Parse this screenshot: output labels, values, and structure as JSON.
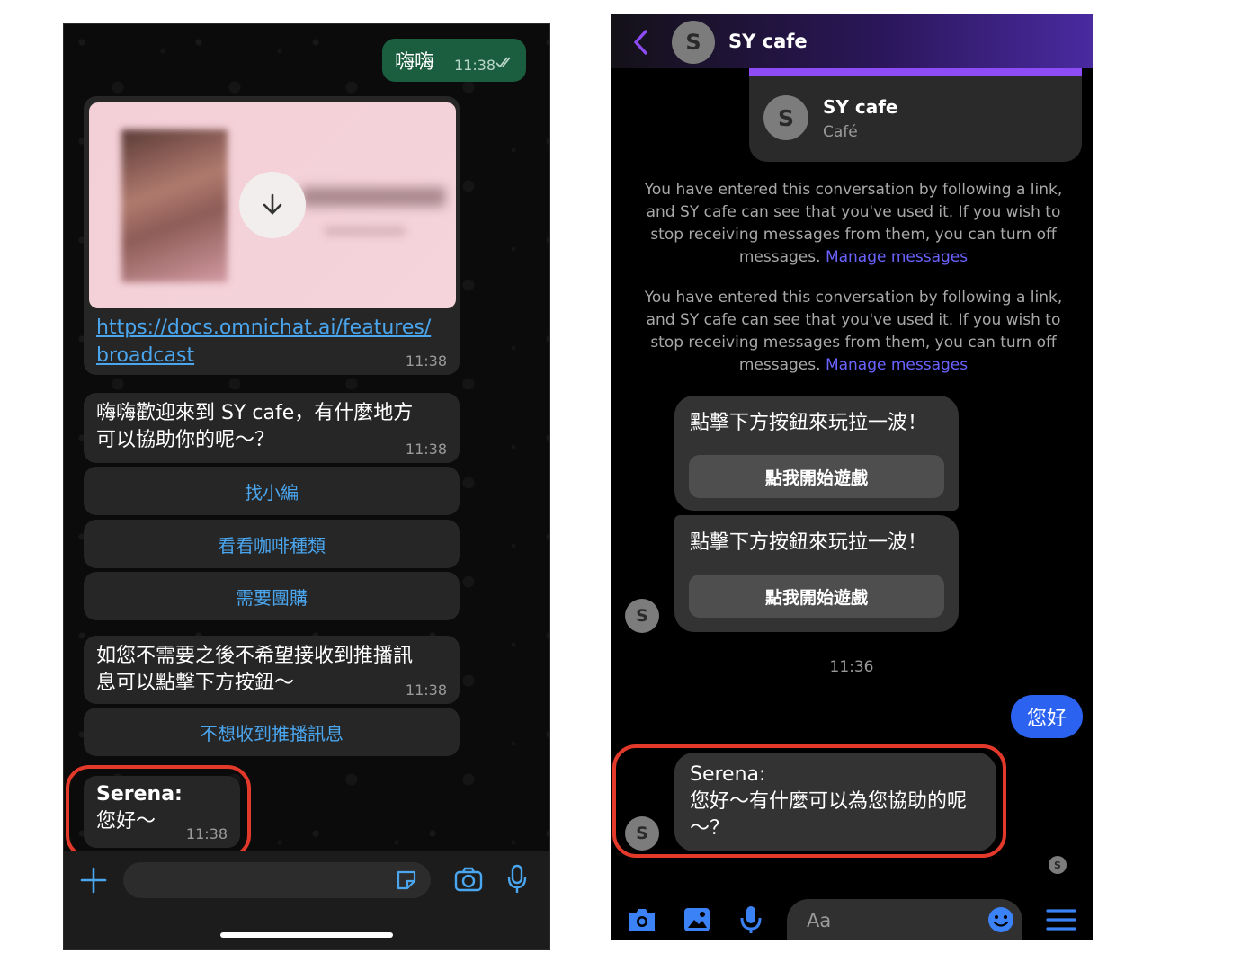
{
  "whatsapp": {
    "outgoing": {
      "text": "嗨嗨",
      "time": "11:38"
    },
    "media": {
      "link_line1": "https://docs.omnichat.ai/features/",
      "link_line2": "broadcast",
      "time": "11:38"
    },
    "welcome": {
      "line1": "嗨嗨歡迎來到 SY cafe，有什麼地方",
      "line2": "可以協助你的呢～？",
      "time": "11:38"
    },
    "quick_replies": [
      "找小編",
      "看看咖啡種類",
      "需要團購"
    ],
    "unsubscribe_msg": {
      "line1": "如您不需要之後不希望接收到推播訊",
      "line2": "息可以點擊下方按鈕～",
      "time": "11:38"
    },
    "unsubscribe_button": "不想收到推播訊息",
    "agent_msg": {
      "name": "Serena:",
      "text": "您好～",
      "time": "11:38"
    },
    "colors": {
      "accent": "#4aa6ef",
      "outgoing_bubble": "#1b5e3f",
      "highlight": "#e2392b"
    }
  },
  "messenger": {
    "header": {
      "avatar_letter": "S",
      "title": "SY cafe"
    },
    "page_card": {
      "avatar_letter": "S",
      "name": "SY cafe",
      "category": "Café"
    },
    "notices": [
      {
        "lines": [
          "You have entered this conversation by following a link,",
          "and SY cafe can see that you've used it. If you wish to",
          "stop receiving messages from them, you can turn off",
          "messages."
        ],
        "link": "Manage messages"
      },
      {
        "lines": [
          "You have entered this conversation by following a link,",
          "and SY cafe can see that you've used it. If you wish to",
          "stop receiving messages from them, you can turn off",
          "messages."
        ],
        "link": "Manage messages"
      }
    ],
    "game_cards": [
      {
        "text": "點擊下方按鈕來玩拉一波！",
        "button": "點我開始遊戲"
      },
      {
        "text": "點擊下方按鈕來玩拉一波！",
        "button": "點我開始遊戲"
      }
    ],
    "bot_avatar_letter": "S",
    "timestamp": "11:36",
    "outgoing": "您好",
    "agent_msg": {
      "line1": "Serena:",
      "line2": "您好～有什麼可以為您協助的呢",
      "line3": "～？"
    },
    "agent_avatar_letter": "S",
    "seen_avatar_letter": "S",
    "composer_placeholder": "Aa",
    "colors": {
      "accent": "#3b82f6",
      "link": "#6b63ff",
      "outgoing_bubble": "#2b63f0",
      "highlight": "#e2392b"
    }
  }
}
